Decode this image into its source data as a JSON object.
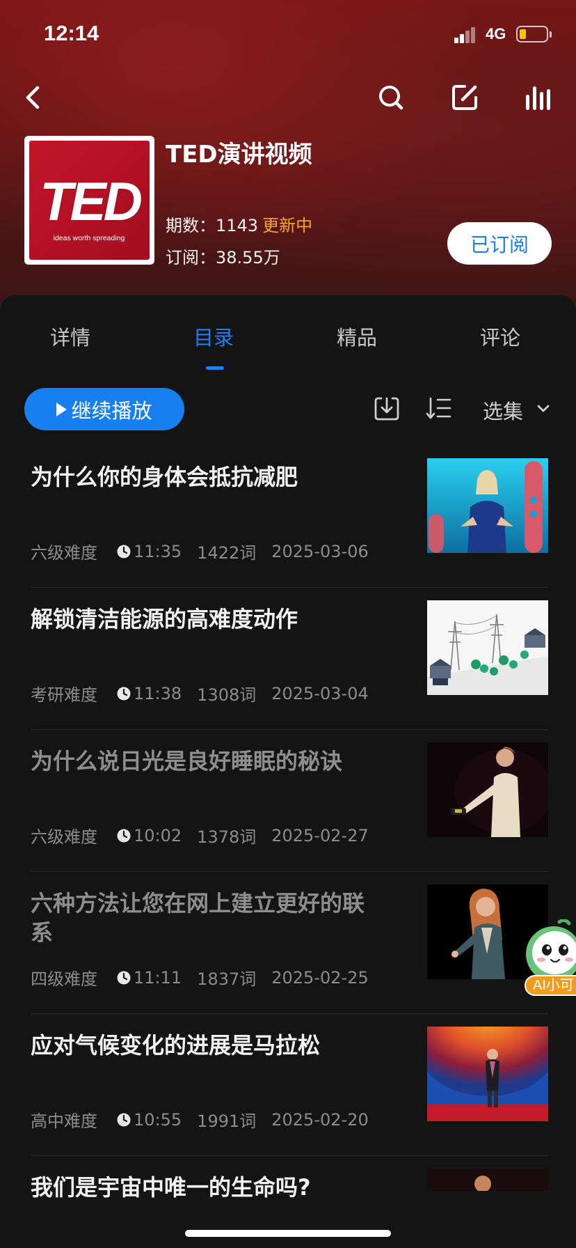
{
  "status": {
    "time": "12:14",
    "network": "4G"
  },
  "podcast": {
    "cover_word": "TED",
    "cover_tagline": "ideas worth spreading",
    "title": "TED演讲视频",
    "episodes_label": "期数：",
    "episodes_value": "1143",
    "updating": "更新中",
    "subs_label": "订阅：",
    "subs_value": "38.55万",
    "subscribe_button": "已订阅"
  },
  "tabs": [
    "详情",
    "目录",
    "精品",
    "评论"
  ],
  "active_tab": "目录",
  "toolbar": {
    "play_label": "继续播放",
    "select_label": "选集"
  },
  "episodes": [
    {
      "title": "为什么你的身体会抵抗减肥",
      "level": "六级难度",
      "duration": "11:35",
      "words": "1422词",
      "date": "2025-03-06",
      "played": false
    },
    {
      "title": "解锁清洁能源的高难度动作",
      "level": "考研难度",
      "duration": "11:38",
      "words": "1308词",
      "date": "2025-03-04",
      "played": false
    },
    {
      "title": "为什么说日光是良好睡眠的秘诀",
      "level": "六级难度",
      "duration": "10:02",
      "words": "1378词",
      "date": "2025-02-27",
      "played": true
    },
    {
      "title": "六种方法让您在网上建立更好的联系",
      "level": "四级难度",
      "duration": "11:11",
      "words": "1837词",
      "date": "2025-02-25",
      "played": true
    },
    {
      "title": "应对气候变化的进展是马拉松",
      "level": "高中难度",
      "duration": "10:55",
      "words": "1991词",
      "date": "2025-02-20",
      "played": false
    },
    {
      "title": "我们是宇宙中唯一的生命吗?",
      "level": "",
      "duration": "",
      "words": "",
      "date": "",
      "played": false
    }
  ],
  "floating_assistant": {
    "label": "AI小可"
  },
  "colors": {
    "accent": "#1e7ff0",
    "updating": "#f4a52b",
    "background": "#141414"
  }
}
